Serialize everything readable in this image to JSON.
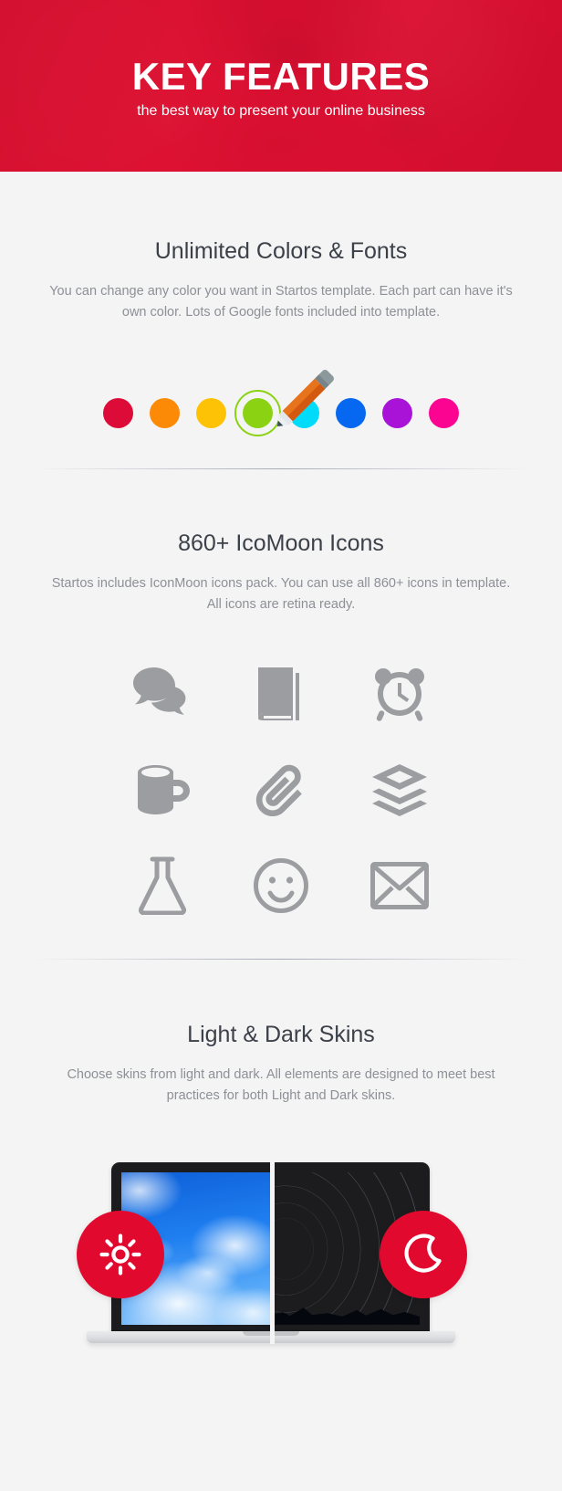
{
  "hero": {
    "title": "KEY FEATURES",
    "subtitle": "the best way to present your online business",
    "background_color": "#d81030",
    "title_color": "#ffffff"
  },
  "sections": [
    {
      "id": "colors",
      "title": "Unlimited Colors & Fonts",
      "description": "You can change any color you want in Startos template. Each part can have it's own color. Lots of Google fonts included into template.",
      "swatches": [
        {
          "name": "red",
          "color": "#dd0b37",
          "selected": false
        },
        {
          "name": "orange",
          "color": "#fc8a06",
          "selected": false
        },
        {
          "name": "amber",
          "color": "#fdc206",
          "selected": false
        },
        {
          "name": "green",
          "color": "#8bd213",
          "selected": true
        },
        {
          "name": "cyan",
          "color": "#00dbfa",
          "selected": false
        },
        {
          "name": "blue",
          "color": "#0668f0",
          "selected": false
        },
        {
          "name": "purple",
          "color": "#a913d8",
          "selected": false
        },
        {
          "name": "magenta",
          "color": "#fc0492",
          "selected": false
        }
      ],
      "pencil": {
        "icon": "pencil-icon",
        "body_color": "#e8731d",
        "shade_color": "#d2590f",
        "eraser_color": "#8b989c",
        "tip_color": "#3a4a58"
      }
    },
    {
      "id": "icons",
      "title": "860+ IcoMoon Icons",
      "description": "Startos includes IconMoon icons pack. You can use all 860+ icons in template. All icons are retina ready.",
      "icon_color": "#9b9da0",
      "icons": [
        {
          "name": "chat-bubbles-icon"
        },
        {
          "name": "book-icon"
        },
        {
          "name": "alarm-clock-icon"
        },
        {
          "name": "coffee-mug-icon"
        },
        {
          "name": "paperclip-icon"
        },
        {
          "name": "layers-icon"
        },
        {
          "name": "flask-icon"
        },
        {
          "name": "smiley-face-icon"
        },
        {
          "name": "envelope-icon"
        }
      ]
    },
    {
      "id": "skins",
      "title": "Light & Dark Skins",
      "description": "Choose skins from light and dark. All elements are designed to meet best practices for both Light and Dark skins.",
      "badges": [
        {
          "name": "sun-icon",
          "label": "light skin",
          "color": "#e2092f"
        },
        {
          "name": "moon-icon",
          "label": "dark skin",
          "color": "#e2092f"
        }
      ]
    }
  ],
  "theme": {
    "page_background": "#f4f4f4",
    "heading_color": "#3c4049",
    "body_text_color": "#8d9096",
    "accent_color": "#e2092f"
  }
}
